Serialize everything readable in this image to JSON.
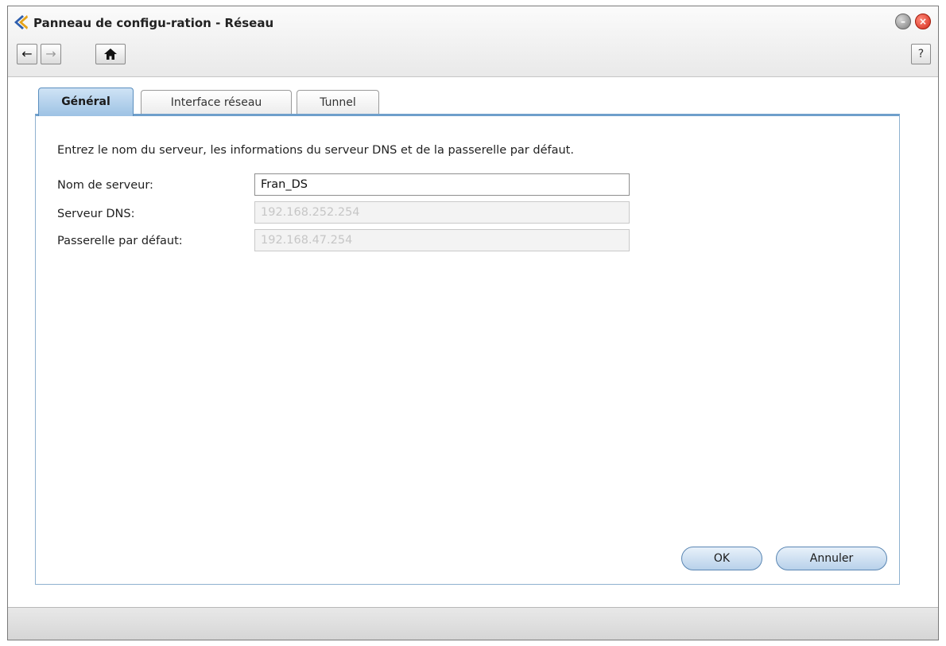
{
  "window": {
    "title": "Panneau de configu-ration - Réseau",
    "app_icon": "synology-x-icon",
    "minimize_glyph": "–",
    "close_glyph": "×"
  },
  "toolbar": {
    "back_glyph": "←",
    "forward_glyph": "→",
    "home_glyph": "⌂",
    "help_label": "?"
  },
  "tabs": [
    {
      "label": "Général",
      "active": true
    },
    {
      "label": "Interface réseau",
      "active": false
    },
    {
      "label": "Tunnel",
      "active": false
    }
  ],
  "form": {
    "intro": "Entrez le nom du serveur, les informations du serveur DNS et de la passerelle par défaut.",
    "server_name": {
      "label": "Nom de serveur:",
      "value": "Fran_DS"
    },
    "dns_server": {
      "label": "Serveur DNS:",
      "value": "192.168.252.254"
    },
    "gateway": {
      "label": "Passerelle par défaut:",
      "value": "192.168.47.254"
    }
  },
  "buttons": {
    "ok": "OK",
    "cancel": "Annuler"
  },
  "colors": {
    "accent": "#6f9fcb",
    "close": "#d32a1a"
  }
}
